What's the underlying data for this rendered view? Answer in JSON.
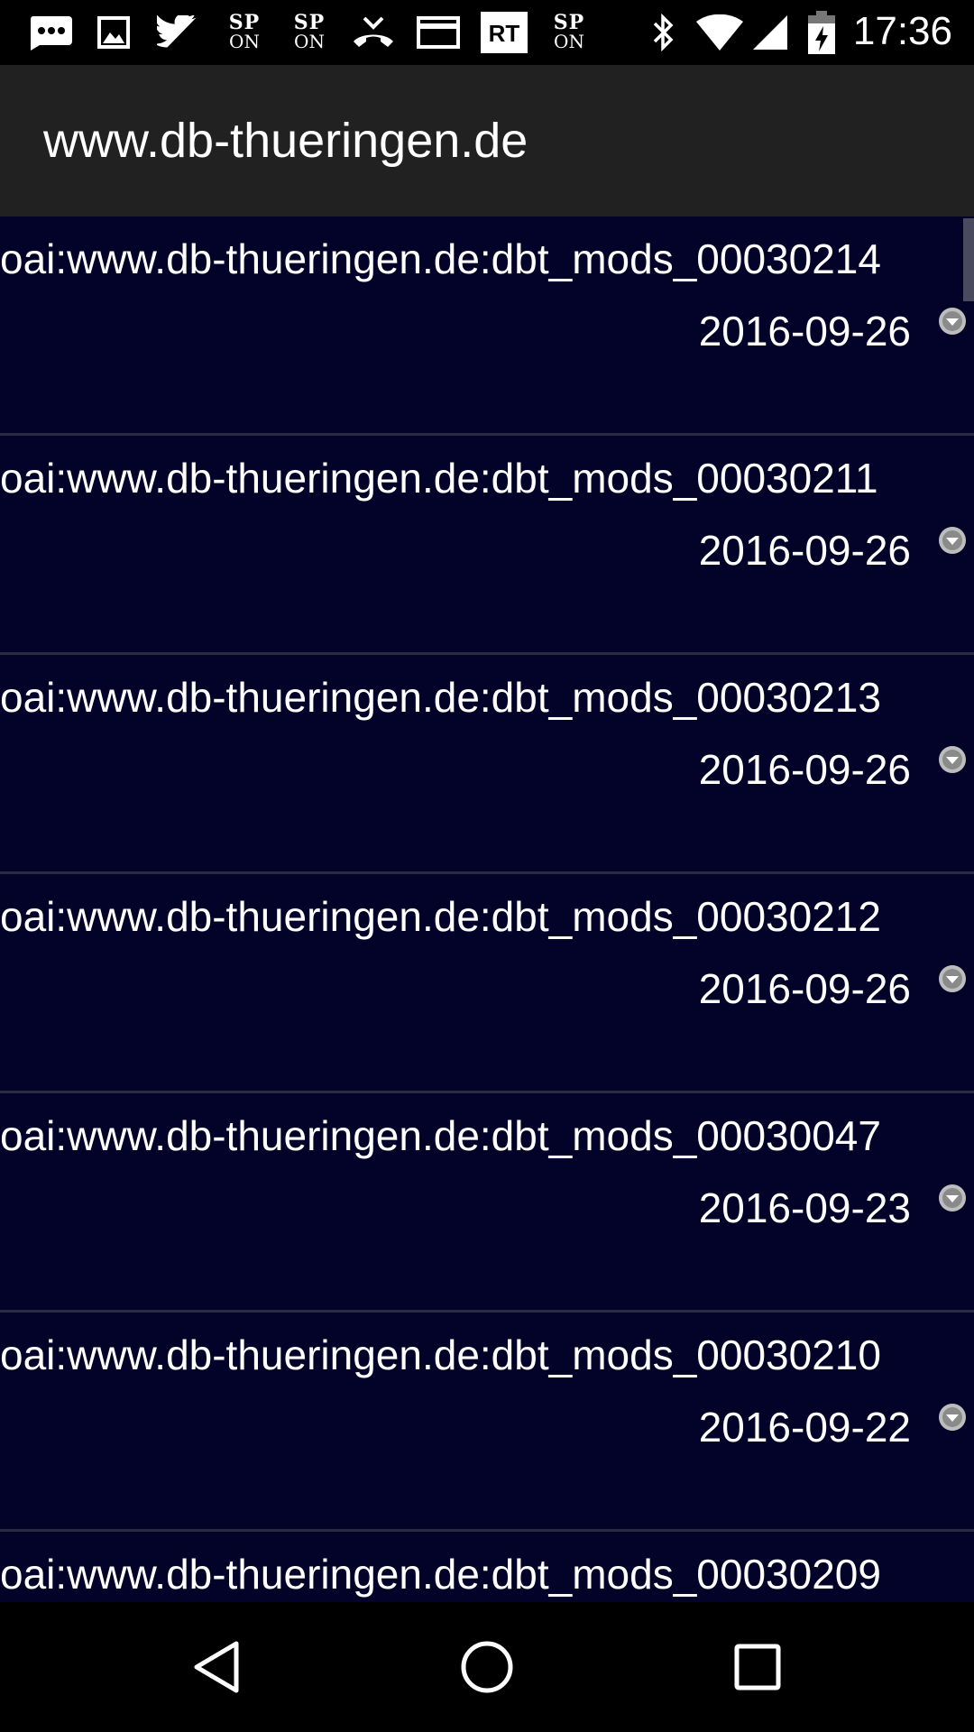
{
  "status_bar": {
    "time": "17:36",
    "icons": [
      "messaging-icon",
      "image-icon",
      "twitter-icon",
      "sp-on-icon",
      "sp-on-icon",
      "missed-call-icon",
      "card-icon",
      "rt-icon",
      "sp-on-icon",
      "bluetooth-icon",
      "wifi-icon",
      "signal-icon",
      "battery-charging-icon"
    ],
    "sp_line1": "SP",
    "sp_line2": "ON",
    "rt_label": "RT"
  },
  "app_bar": {
    "title": "www.db-thueringen.de"
  },
  "list": {
    "items": [
      {
        "id": "oai:www.db-thueringen.de:dbt_mods_00030214",
        "date": "2016-09-26"
      },
      {
        "id": "oai:www.db-thueringen.de:dbt_mods_00030211",
        "date": "2016-09-26"
      },
      {
        "id": "oai:www.db-thueringen.de:dbt_mods_00030213",
        "date": "2016-09-26"
      },
      {
        "id": "oai:www.db-thueringen.de:dbt_mods_00030212",
        "date": "2016-09-26"
      },
      {
        "id": "oai:www.db-thueringen.de:dbt_mods_00030047",
        "date": "2016-09-23"
      },
      {
        "id": "oai:www.db-thueringen.de:dbt_mods_00030210",
        "date": "2016-09-22"
      },
      {
        "id": "oai:www.db-thueringen.de:dbt_mods_00030209",
        "date": ""
      }
    ]
  },
  "nav_bar": {
    "buttons": [
      "back-icon",
      "home-icon",
      "recents-icon"
    ]
  },
  "colors": {
    "list_background": "#03032a",
    "app_bar": "#212121",
    "divider": "#2a2a44"
  }
}
